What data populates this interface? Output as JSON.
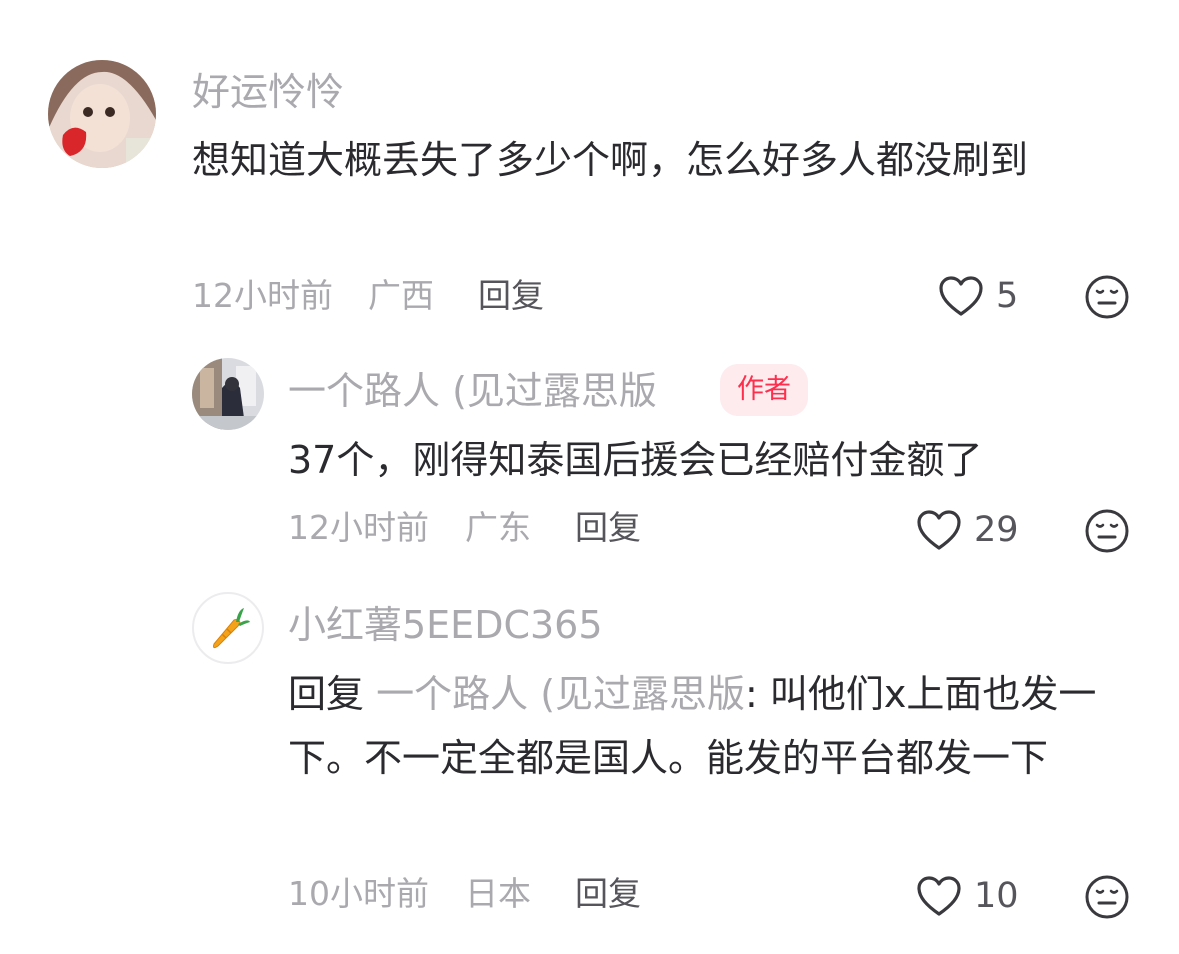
{
  "comments": [
    {
      "user": "好运怜怜",
      "text": "想知道大概丢失了多少个啊，怎么好多人都没刷到",
      "time": "12小时前",
      "location": "广西",
      "reply_label": "回复",
      "likes": "5",
      "replies": [
        {
          "user": "一个路人 (见过露思版",
          "badge": "作者",
          "text": "37个，刚得知泰国后援会已经赔付金额了",
          "time": "12小时前",
          "location": "广东",
          "reply_label": "回复",
          "likes": "29"
        },
        {
          "user": "小红薯5EEDC365",
          "reply_prefix": "回复",
          "reply_to": "一个路人 (见过露思版",
          "text": ": 叫他们x上面也发一下。不一定全都是国人。能发的平台都发一下",
          "time": "10小时前",
          "location": "日本",
          "reply_label": "回复",
          "likes": "10"
        }
      ]
    }
  ],
  "icons": {
    "like": "heart-outline-icon",
    "dislike": "neutral-face-icon",
    "avatar3": "carrot-icon"
  },
  "colors": {
    "badge_text": "#ff2e4d",
    "badge_bg": "#fdebee",
    "secondary_text": "#a9a9ae",
    "primary_text": "#2b2b2f"
  }
}
